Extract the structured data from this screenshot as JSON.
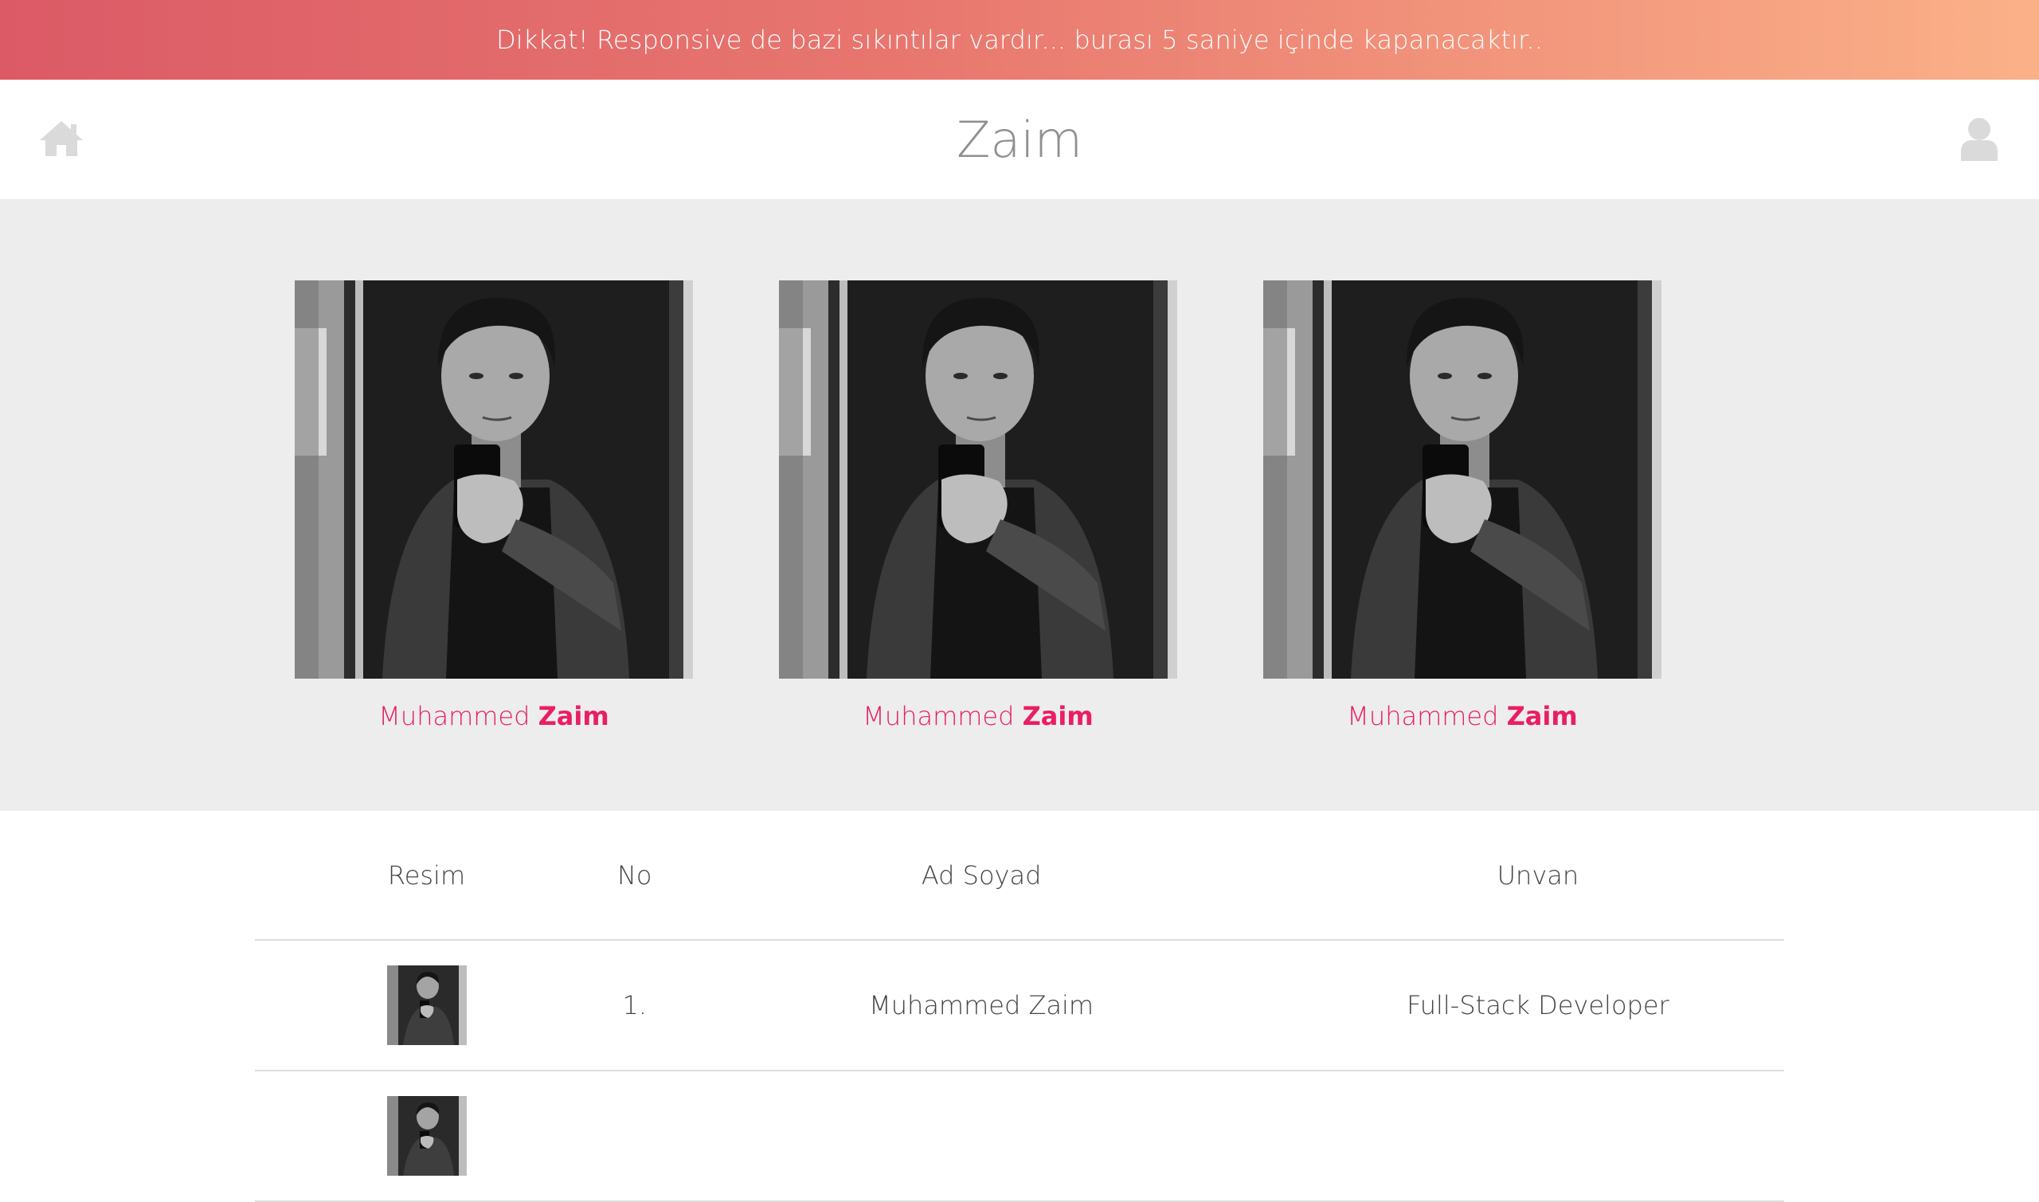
{
  "alert": {
    "message": "Dikkat! Responsive de bazi sıkıntılar vardır... burası 5 saniye içinde kapanacaktır.."
  },
  "header": {
    "title": "Zaim",
    "home_icon": "home-icon",
    "user_icon": "user-icon"
  },
  "team": {
    "cards": [
      {
        "first_name": "Muhammed",
        "last_name": "Zaim"
      },
      {
        "first_name": "Muhammed",
        "last_name": "Zaim"
      },
      {
        "first_name": "Muhammed",
        "last_name": "Zaim"
      }
    ]
  },
  "table": {
    "headers": [
      "Resim",
      "No",
      "Ad Soyad",
      "Unvan"
    ],
    "rows": [
      {
        "no": "1.",
        "name": "Muhammed Zaim",
        "title": "Full-Stack Developer"
      },
      {
        "no": "",
        "name": "",
        "title": ""
      }
    ]
  },
  "colors": {
    "banner_start": "#db5a66",
    "banner_end": "#fbb188",
    "accent": "#e91e63",
    "section_bg": "#ededed",
    "icon": "#dadada"
  }
}
